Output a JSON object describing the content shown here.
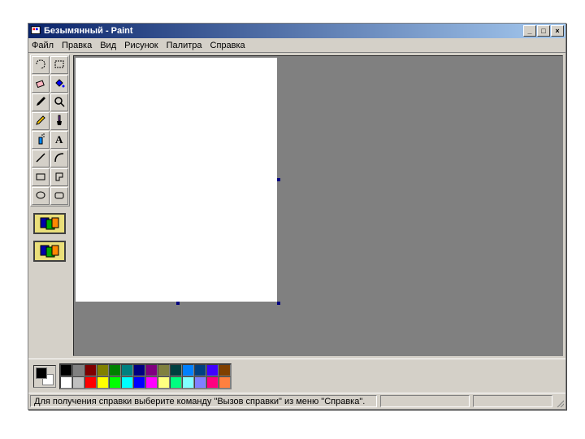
{
  "title": "Безымянный - Paint",
  "window_buttons": {
    "min": "_",
    "max": "□",
    "close": "×"
  },
  "menu": [
    "Файл",
    "Правка",
    "Вид",
    "Рисунок",
    "Палитра",
    "Справка"
  ],
  "tools": [
    "free-select-icon",
    "rect-select-icon",
    "eraser-icon",
    "fill-icon",
    "dropper-icon",
    "zoom-icon",
    "pencil-icon",
    "brush-icon",
    "spray-icon",
    "text-icon",
    "line-icon",
    "curve-icon",
    "rectangle-icon",
    "polygon-icon",
    "ellipse-icon",
    "roundrect-icon"
  ],
  "palette_row1": [
    "#000000",
    "#808080",
    "#800000",
    "#808000",
    "#008000",
    "#008080",
    "#000080",
    "#800080",
    "#808040",
    "#004040",
    "#0080ff",
    "#004080",
    "#4000ff",
    "#804000"
  ],
  "palette_row2": [
    "#ffffff",
    "#c0c0c0",
    "#ff0000",
    "#ffff00",
    "#00ff00",
    "#00ffff",
    "#0000ff",
    "#ff00ff",
    "#ffff80",
    "#00ff80",
    "#80ffff",
    "#8080ff",
    "#ff0080",
    "#ff8040"
  ],
  "current_colors": {
    "fg": "#000000",
    "bg": "#ffffff"
  },
  "status_text": "Для получения справки выберите команду \"Вызов справки\" из меню \"Справка\"."
}
